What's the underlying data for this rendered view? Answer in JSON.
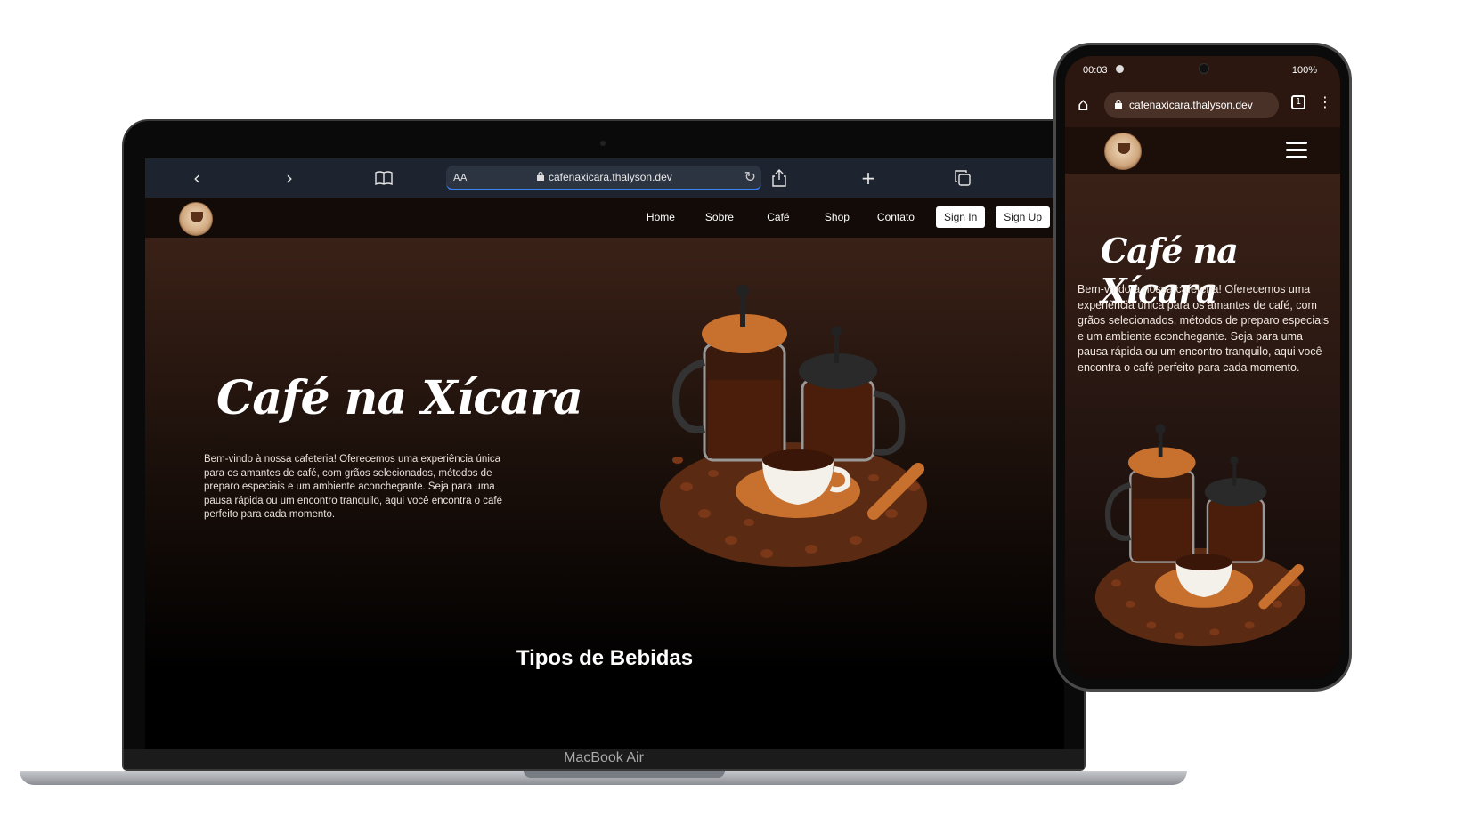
{
  "laptop": {
    "device_label": "MacBook Air",
    "browser": {
      "back_icon": "chevron-left-icon",
      "forward_icon": "chevron-right-icon",
      "bookmarks_icon": "book-icon",
      "text_size_label": "AA",
      "url": "cafenaxicara.thalyson.dev",
      "share_icon": "share-icon",
      "new_tab_icon": "plus-icon",
      "tabs_icon": "tabs-icon"
    },
    "site": {
      "nav": [
        "Home",
        "Sobre",
        "Café",
        "Shop",
        "Contato"
      ],
      "sign_in": "Sign In",
      "sign_up": "Sign Up",
      "hero_title": "Café na Xícara",
      "hero_text": "Bem-vindo à nossa cafeteria! Oferecemos uma experiência única para os amantes de café, com grãos selecionados, métodos de preparo especiais e um ambiente aconchegante. Seja para uma pausa rápida ou um encontro tranquilo, aqui você encontra o café perfeito para cada momento.",
      "section_title": "Tipos de Bebidas"
    }
  },
  "phone": {
    "status": {
      "time": "00:03",
      "battery": "100%"
    },
    "browser": {
      "url": "cafenaxicara.thalyson.dev",
      "tab_count": "1"
    },
    "site": {
      "hero_title": "Café na Xícara",
      "hero_text": "Bem-vindo à nossa cafeteria! Oferecemos uma experiência única para os amantes de café, com grãos selecionados, métodos de preparo especiais e um ambiente aconchegante. Seja para uma pausa rápida ou um encontro tranquilo, aqui você encontra o café perfeito para cada momento."
    }
  },
  "colors": {
    "nav_bg": "#120b07",
    "hero_top": "#3a2117",
    "accent_copper": "#c8702e",
    "safari_bar": "#1d2430"
  }
}
